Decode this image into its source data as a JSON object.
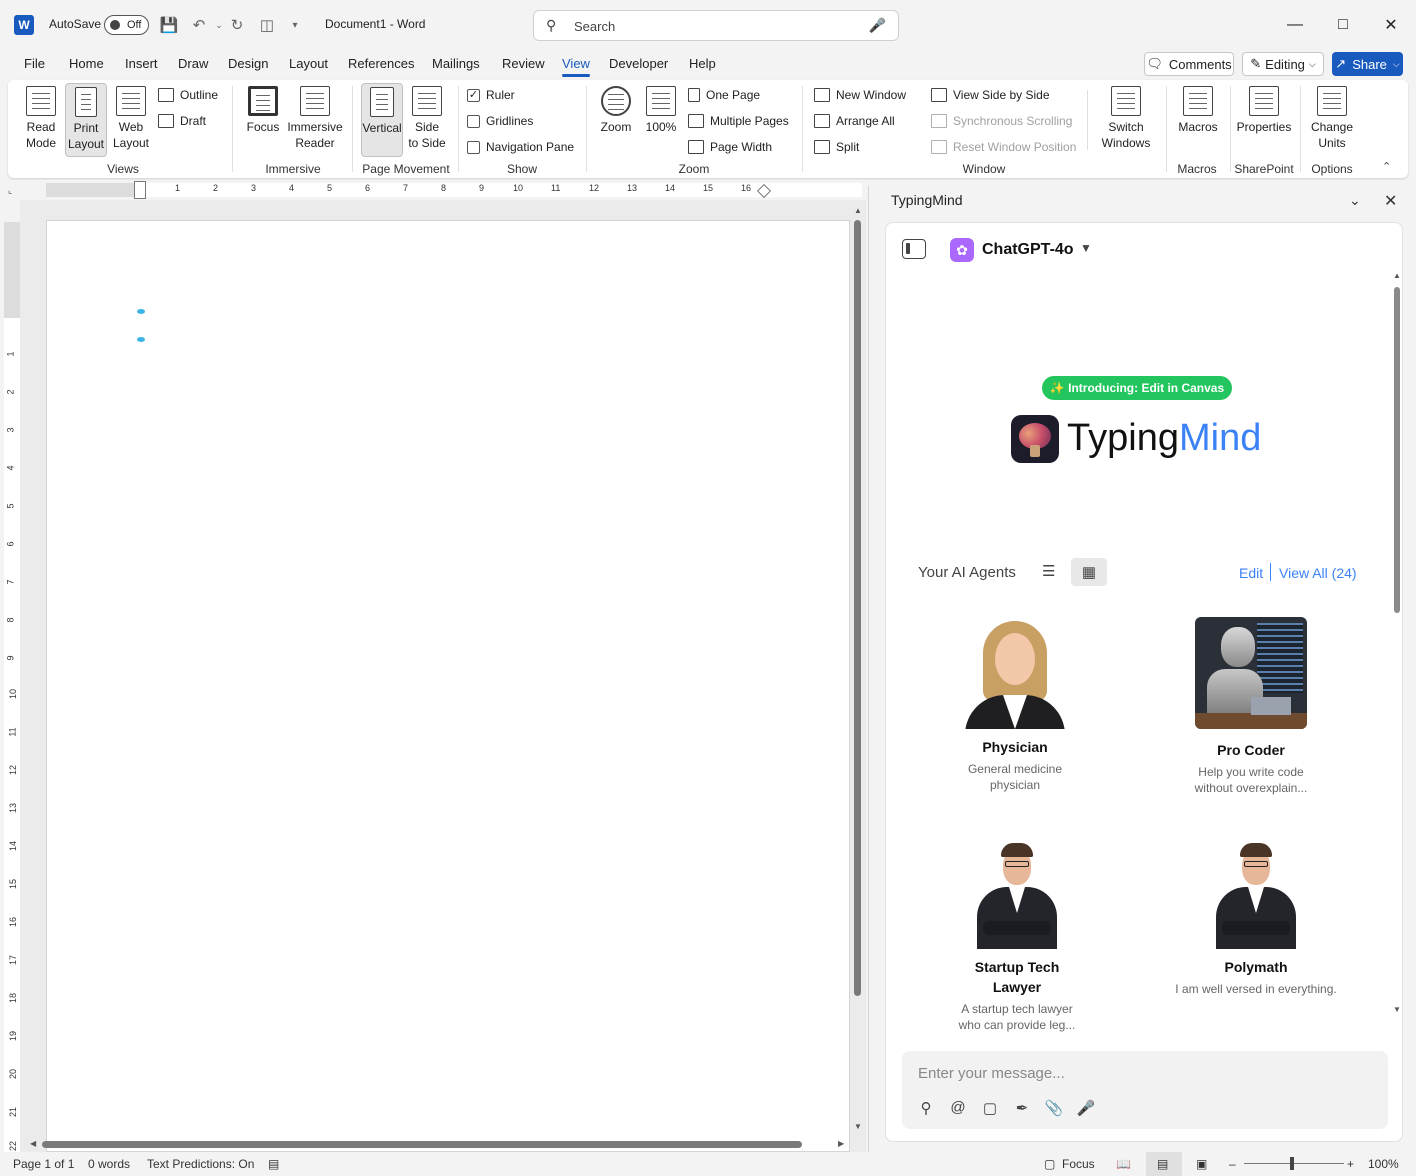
{
  "titlebar": {
    "app_icon": "W",
    "autosave_label": "AutoSave",
    "autosave_state": "Off",
    "document_title": "Document1  -  Word",
    "search_placeholder": "Search",
    "icons": [
      "save-icon",
      "undo-icon",
      "redo-icon",
      "touch-mode-icon",
      "customize-qat-icon",
      "search-icon",
      "mic-icon",
      "minimize-icon",
      "maximize-icon",
      "close-icon"
    ]
  },
  "menu": {
    "tabs": [
      "File",
      "Home",
      "Insert",
      "Draw",
      "Design",
      "Layout",
      "References",
      "Mailings",
      "Review",
      "View",
      "Developer",
      "Help"
    ],
    "active_tab": "View",
    "comments_label": "Comments",
    "editing_label": "Editing",
    "share_label": "Share"
  },
  "ribbon": {
    "views": {
      "group": "Views",
      "read_mode": [
        "Read",
        "Mode"
      ],
      "print_layout": [
        "Print",
        "Layout"
      ],
      "web_layout": [
        "Web",
        "Layout"
      ],
      "outline": "Outline",
      "draft": "Draft"
    },
    "immersive": {
      "group": "Immersive",
      "focus": "Focus",
      "immersive_reader": [
        "Immersive",
        "Reader"
      ]
    },
    "page_movement": {
      "group": "Page Movement",
      "vertical": "Vertical",
      "side_to_side": [
        "Side",
        "to Side"
      ]
    },
    "show": {
      "group": "Show",
      "ruler": "Ruler",
      "ruler_checked": true,
      "gridlines": "Gridlines",
      "navigation_pane": "Navigation Pane"
    },
    "zoom": {
      "group": "Zoom",
      "zoom": "Zoom",
      "hundred": "100%",
      "one_page": "One Page",
      "multiple_pages": "Multiple Pages",
      "page_width": "Page Width"
    },
    "window": {
      "group": "Window",
      "new_window": "New Window",
      "arrange_all": "Arrange All",
      "split": "Split",
      "view_side_by_side": "View Side by Side",
      "synchronous_scrolling": "Synchronous Scrolling",
      "reset_window_position": "Reset Window Position",
      "switch_windows": [
        "Switch",
        "Windows"
      ]
    },
    "macros": {
      "group": "Macros",
      "macros": "Macros"
    },
    "sharepoint": {
      "group": "SharePoint",
      "properties": "Properties"
    },
    "options": {
      "group": "Options",
      "change_units": [
        "Change",
        "Units"
      ]
    }
  },
  "ruler": {
    "h_numbers": [
      "1",
      "2",
      "3",
      "4",
      "5",
      "6",
      "7",
      "8",
      "9",
      "10",
      "11",
      "12",
      "13",
      "14",
      "15",
      "16"
    ],
    "v_numbers": [
      "1",
      "2",
      "3",
      "4",
      "5",
      "6",
      "7",
      "8",
      "9",
      "10",
      "11",
      "12",
      "13",
      "14",
      "15",
      "16",
      "17",
      "18",
      "19",
      "20",
      "21",
      "22"
    ]
  },
  "typingmind": {
    "pane_title": "TypingMind",
    "model_name": "ChatGPT-4o",
    "badge": "✨ Introducing: Edit in Canvas",
    "brand_part1": "Typing",
    "brand_part2": "Mind",
    "agents_label": "Your AI Agents",
    "edit_label": "Edit",
    "view_all_label": "View All (24)",
    "agents": [
      {
        "name": "Physician",
        "desc": "General medicine physician"
      },
      {
        "name": "Pro Coder",
        "desc": "Help you write code without overexplain..."
      },
      {
        "name": "Startup Tech Lawyer",
        "desc": "A startup tech lawyer who can provide leg..."
      },
      {
        "name": "Polymath",
        "desc": "I am well versed in everything."
      }
    ],
    "input_placeholder": "Enter your message...",
    "tools": [
      "search-icon",
      "mention-icon",
      "bookmark-icon",
      "pen-icon",
      "paperclip-icon",
      "mic-icon"
    ],
    "colors": {
      "accent": "#3b82f6",
      "badge": "#22c55e",
      "model_icon": "#ab68ff"
    }
  },
  "statusbar": {
    "page": "Page 1 of 1",
    "words": "0 words",
    "text_predictions": "Text Predictions: On",
    "focus": "Focus",
    "zoom": "100%"
  },
  "colors": {
    "word_blue": "#185abd",
    "ribbon_bg": "#ffffff",
    "chrome_bg": "#f3f3f3"
  }
}
